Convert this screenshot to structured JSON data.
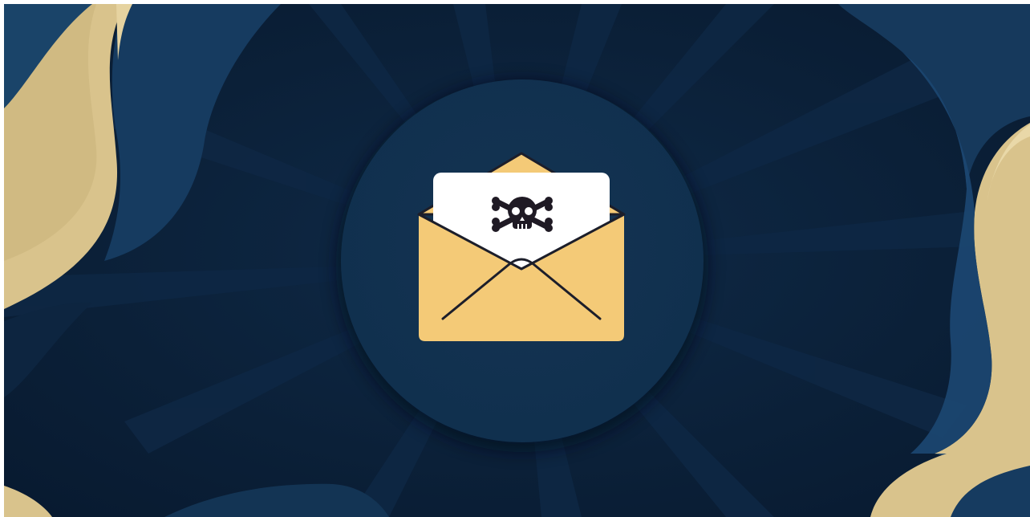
{
  "illustration": {
    "subject": "envelope-with-skull-letter",
    "icons": [
      "envelope-icon",
      "skull-crossbones-icon"
    ]
  },
  "colors": {
    "background": "#0b2038",
    "background_deep": "#07172a",
    "wave_blue": "#143a5e",
    "wave_blue_light": "#1d4a72",
    "wave_gold": "#d9c38c",
    "wave_gold_light": "#e6d3a0",
    "circle": "#12304f",
    "envelope": "#f4ca77",
    "envelope_line": "#1c1e2a",
    "letter": "#ffffff",
    "skull": "#1f1a24"
  }
}
